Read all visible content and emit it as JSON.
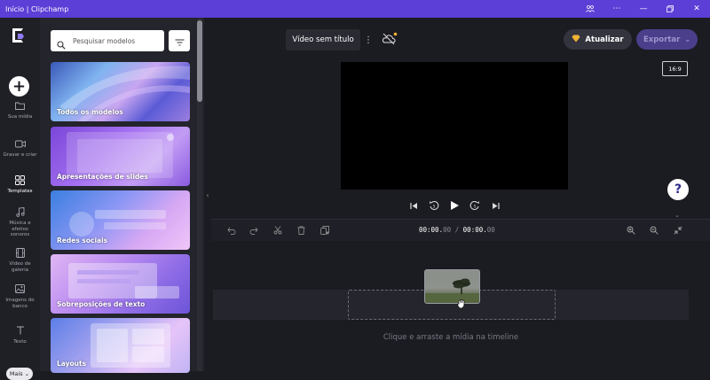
{
  "window": {
    "title": "Início | Clipchamp"
  },
  "nav": {
    "create_label": "+",
    "items": [
      {
        "label": "Sua mídia",
        "icon": "folder-icon"
      },
      {
        "label": "Gravar e criar",
        "icon": "video-camera-icon"
      },
      {
        "label": "Templates",
        "icon": "templates-icon",
        "active": true
      },
      {
        "label": "Música e efeitos sonoros",
        "icon": "music-note-icon"
      },
      {
        "label": "Vídeo de galeria",
        "icon": "film-icon"
      },
      {
        "label": "Imagens do banco",
        "icon": "image-icon"
      },
      {
        "label": "Texto",
        "icon": "text-icon"
      }
    ],
    "more_label": "Mais"
  },
  "panel": {
    "search_placeholder": "Pesquisar modelos",
    "cards": [
      {
        "label": "Todos os modelos"
      },
      {
        "label": "Apresentações de slides"
      },
      {
        "label": "Redes sociais"
      },
      {
        "label": "Sobreposições de texto"
      },
      {
        "label": "Layouts"
      }
    ]
  },
  "header": {
    "project_title": "Vídeo sem título",
    "upgrade_label": "Atualizar",
    "export_label": "Exportar",
    "aspect_ratio": "16:9"
  },
  "help": {
    "label": "?"
  },
  "timeline": {
    "current_time": "00:00.",
    "current_ms": "00",
    "separator": "/",
    "duration": "00:00.",
    "duration_ms": "00",
    "hint": "Clique e arraste a mídia na timeline"
  },
  "colors": {
    "titlebar": "#5b3fd6",
    "accent": "#4b3f8c",
    "background": "#1b1b22"
  }
}
